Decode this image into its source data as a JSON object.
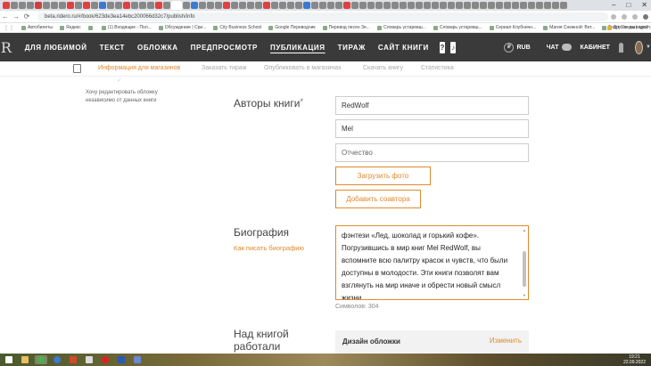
{
  "browser": {
    "url": "beta.ridero.ru/#/book/623de3ea14ebc200066d32c7/publish/info",
    "bookmarks": [
      "Автобилеты",
      "Яндекс",
      "",
      "(1) Входящие - Пол...",
      "Обсуждение | Сри...",
      "City Business School",
      "Google Переводчик",
      "Перевод песен Зе...",
      "Словарь устаревш...",
      "Словарь устаревш...",
      "Сериал Клубничн...",
      "Магия Снежной: Вет...",
      "Текст Сонды | пройт..."
    ],
    "bookmarks_right": "Другие закладки"
  },
  "nav": {
    "logo": "R",
    "items": [
      {
        "label": "ДЛЯ ЛЮБИМОЙ",
        "active": false
      },
      {
        "label": "ТЕКСТ",
        "active": false
      },
      {
        "label": "ОБЛОЖКА",
        "active": false
      },
      {
        "label": "ПРЕДПРОСМОТР",
        "active": false
      },
      {
        "label": "ПУБЛИКАЦИЯ",
        "active": true
      },
      {
        "label": "ТИРАЖ",
        "active": false
      },
      {
        "label": "САЙТ КНИГИ",
        "active": false
      }
    ],
    "help_label": "?",
    "music_label": "♪",
    "currency_symbol": "₽",
    "currency": "RUB",
    "chat": "ЧАТ",
    "cabinet": "КАБИНЕТ"
  },
  "subtabs": [
    "Информация для магазинов",
    "Заказать тираж",
    "Опубликовать в магазинах",
    "Скачать книгу",
    "Статистика"
  ],
  "sidebar": {
    "note": "Хочу редактировать обложку независимо от данных книги"
  },
  "authors": {
    "label": "Авторы книги",
    "required_mark": "*",
    "first_name": "RedWolf",
    "last_name": "Mel",
    "patronymic_placeholder": "Отчество",
    "upload_photo": "Загрузить фото",
    "add_coauthor": "Добавить соавтора"
  },
  "biography": {
    "label": "Биография",
    "help_link": "Как писать биографию",
    "text": "фэнтези «Лед, шоколад и горький кофе». Погрузившись в мир книг Mel RedWolf, вы вспомните всю палитру красок и чувств, что были доступны в молодости. Эти книги позволят вам взглянуть на мир иначе и обрести новый смысл жизни.",
    "char_count": "Символов: 304"
  },
  "worked_on": {
    "label": "Над книгой работали",
    "card_title": "Дизайн обложки",
    "card_action": "Изменить"
  },
  "taskbar": {
    "time": "19:21",
    "date": "22.09.2022"
  },
  "colors": {
    "accent": "#e08a2c",
    "nav_bg": "#3a3a3a"
  }
}
